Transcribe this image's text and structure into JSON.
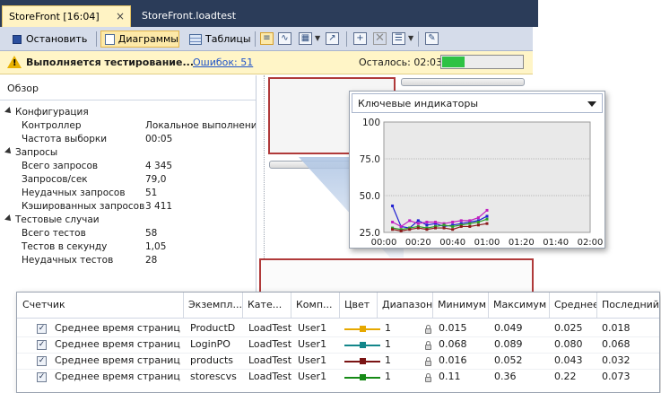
{
  "tabs": [
    {
      "label": "StoreFront [16:04]",
      "close": "×",
      "active": true
    },
    {
      "label": "StoreFront.loadtest",
      "active": false
    }
  ],
  "toolbar": {
    "stop_label": "Остановить",
    "charts_label": "Диаграммы",
    "tables_label": "Таблицы"
  },
  "status": {
    "running_text": "Выполняется тестирование...",
    "errors_link": "Ошибок: 51",
    "remaining": "Осталось: 02:03",
    "progress": 0.28
  },
  "overview": {
    "title": "Обзор",
    "sections": [
      {
        "title": "Конфигурация",
        "items": [
          {
            "label": "Контроллер",
            "value": "Локальное выполнение"
          },
          {
            "label": "Частота выборки",
            "value": "00:05"
          }
        ]
      },
      {
        "title": "Запросы",
        "items": [
          {
            "label": "Всего запросов",
            "value": "4 345"
          },
          {
            "label": "Запросов/сек",
            "value": "79,0"
          },
          {
            "label": "Неудачных запросов",
            "value": "51"
          },
          {
            "label": "Кэшированных запросов",
            "value": "3 411"
          }
        ]
      },
      {
        "title": "Тестовые случаи",
        "items": [
          {
            "label": "Всего тестов",
            "value": "58"
          },
          {
            "label": "Тестов в секунду",
            "value": "1,05"
          },
          {
            "label": "Неудачных тестов",
            "value": "28"
          }
        ]
      }
    ]
  },
  "popup": {
    "selector": "Ключевые индикаторы"
  },
  "chart_data": {
    "type": "line",
    "title": "",
    "xlabel": "",
    "ylabel": "",
    "ylim": [
      25,
      100
    ],
    "y_ticks": [
      "100",
      "75.0",
      "50.0",
      "25.0"
    ],
    "x_ticks": [
      "00:00",
      "00:20",
      "00:40",
      "01:00",
      "01:20",
      "01:40",
      "02:00"
    ],
    "x": [
      5,
      10,
      15,
      20,
      25,
      30,
      35,
      40,
      45,
      50,
      55,
      60
    ],
    "series": [
      {
        "color": "#1f1fd1",
        "values": [
          43,
          29,
          28,
          33,
          30,
          31,
          29,
          30,
          31,
          32,
          33,
          36
        ]
      },
      {
        "color": "#c01fc0",
        "values": [
          32,
          29,
          33,
          31,
          32,
          32,
          31,
          32,
          33,
          33,
          35,
          40
        ]
      },
      {
        "color": "#2ba02b",
        "values": [
          28,
          27,
          28,
          29,
          28,
          29,
          30,
          29,
          30,
          31,
          32,
          34
        ]
      },
      {
        "color": "#8b1a1a",
        "values": [
          27,
          26,
          27,
          28,
          27,
          28,
          28,
          27,
          29,
          29,
          30,
          31
        ]
      }
    ],
    "grid": true
  },
  "table": {
    "columns": [
      "Счетчик",
      "Экземпл...",
      "Кате...",
      "Комп...",
      "Цвет",
      "Диапазон",
      "Минимум",
      "Максимум",
      "Среднее",
      "Последний"
    ],
    "rows": [
      {
        "counter": "Среднее время страницы",
        "instance": "ProductD",
        "category": "LoadTest:",
        "computer": "User1",
        "color": "#e6a800",
        "range": "1",
        "min": "0.015",
        "max": "0.049",
        "avg": "0.025",
        "last": "0.018"
      },
      {
        "counter": "Среднее время страницы",
        "instance": "LoginPO",
        "category": "LoadTest:",
        "computer": "User1",
        "color": "#13868a",
        "range": "1",
        "min": "0.068",
        "max": "0.089",
        "avg": "0.080",
        "last": "0.068"
      },
      {
        "counter": "Среднее время страницы",
        "instance": "products",
        "category": "LoadTest:",
        "computer": "User1",
        "color": "#7a1414",
        "range": "1",
        "min": "0.016",
        "max": "0.052",
        "avg": "0.043",
        "last": "0.032"
      },
      {
        "counter": "Среднее время страницы",
        "instance": "storescvs",
        "category": "LoadTest:",
        "computer": "User1",
        "color": "#168a16",
        "range": "1",
        "min": "0.11",
        "max": "0.36",
        "avg": "0.22",
        "last": "0.073"
      }
    ]
  }
}
